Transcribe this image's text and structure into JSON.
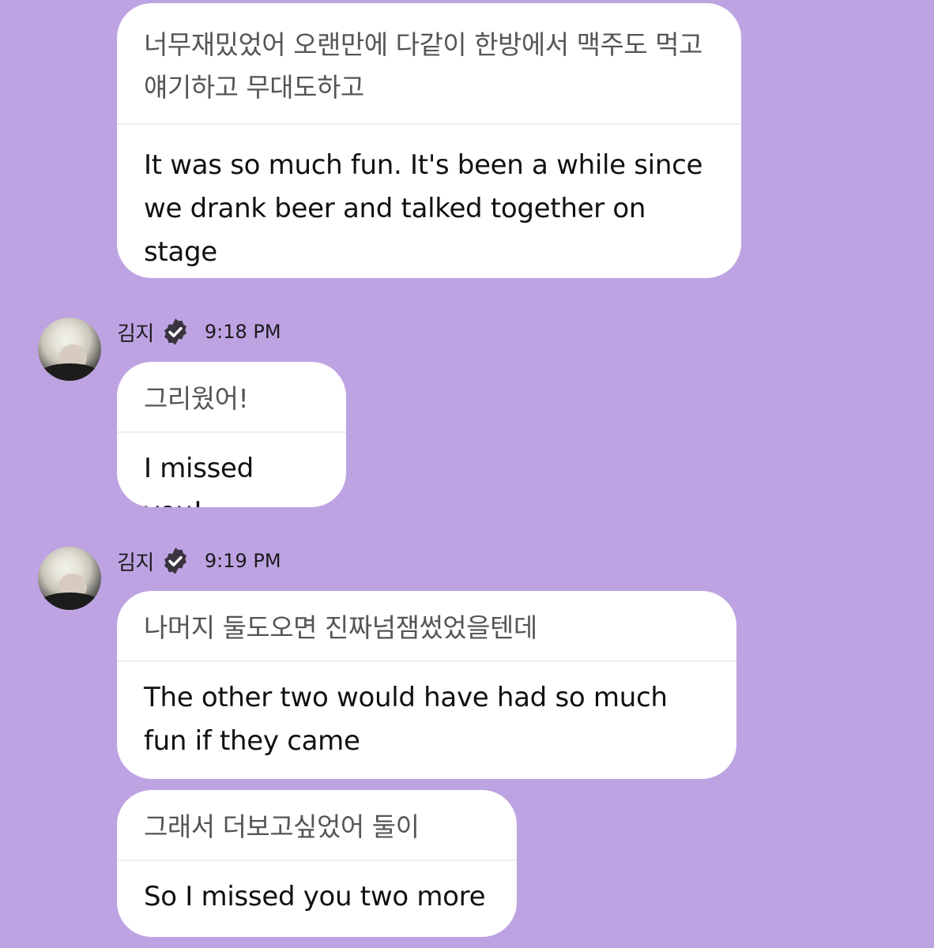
{
  "messages": [
    {
      "original": "너무재밌었어 오랜만에 다같이 한방에서 맥주도 먹고 얘기하고 무대도하고",
      "translation": "It was so much fun. It's been a while since we drank beer and talked together on stage"
    },
    {
      "sender": "김지",
      "time": "9:18 PM",
      "original": "그리웠어!",
      "translation": "I missed you!"
    },
    {
      "sender": "김지",
      "time": "9:19 PM",
      "original": "나머지 둘도오면 진짜넘잼썼었을텐데",
      "translation": "The other two would have had so much fun if they came"
    },
    {
      "original": "그래서 더보고싶었어 둘이",
      "translation": "So I missed you two more"
    }
  ],
  "icons": {
    "verified": "verified-badge-icon",
    "avatar": "user-avatar"
  },
  "colors": {
    "background": "#bea3e3",
    "bubble": "#ffffff",
    "original_text": "#555555",
    "translation_text": "#111111"
  }
}
